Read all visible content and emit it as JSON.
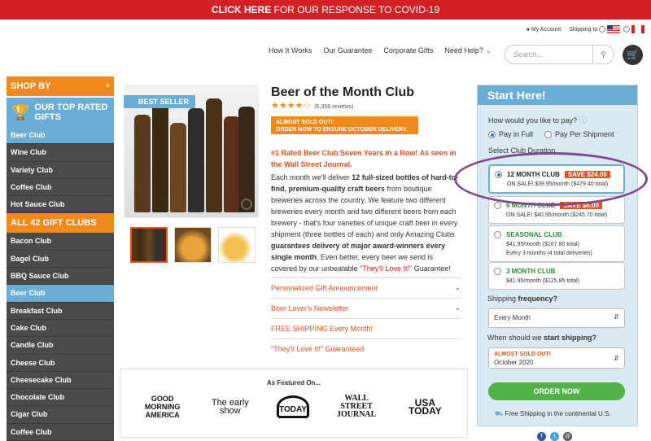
{
  "banner": {
    "click_here": "CLICK HERE",
    "text": " FOR OUR RESPONSE TO COVID-19"
  },
  "utility": {
    "account": "My Account",
    "shipping_to": "Shipping to"
  },
  "nav": {
    "items": [
      "How It Works",
      "Our Guarantee",
      "Corporate Gifts",
      "Need Help?"
    ]
  },
  "search": {
    "placeholder": "Search..."
  },
  "sidebar": {
    "shop_by": "SHOP BY",
    "top_rated": "OUR TOP RATED GIFTS",
    "top_items": [
      "Beer Club",
      "Wine Club",
      "Variety Club",
      "Coffee Club",
      "Hot Sauce Club"
    ],
    "all_clubs": "ALL 42 GIFT CLUBS",
    "all_items": [
      "Bacon Club",
      "Bagel Club",
      "BBQ Sauce Club",
      "Beer Club",
      "Breakfast Club",
      "Cake Club",
      "Candle Club",
      "Cheese Club",
      "Cheesecake Club",
      "Chocolate Club",
      "Cigar Club",
      "Coffee Club"
    ]
  },
  "product": {
    "badge": "BEST SELLER",
    "title": "Beer of the Month Club",
    "rating": 4.5,
    "reviews": "(5,358 reviews)",
    "soldout_line1": "ALMOST SOLD OUT!",
    "soldout_line2": "ORDER NOW TO ENSURE OCTOBER DELIVERY.",
    "rated_line": "#1 Rated Beer Club Seven Years in a Row! As seen in the Wall Street Journal.",
    "desc_1": "Each month we'll deliver ",
    "desc_2": "12 full-sized bottles of hard-to-find, premium-quality craft beers",
    "desc_3": " from boutique breweries across the country. We feature two different breweries every month and two different beers from each brewery - that's four varieties of unique craft beer in every shipment (three bottles of each) and only Amazing Clubs ",
    "desc_4": "guarantees delivery of major award-winners every single month",
    "desc_5": ". Even better, every beer we send is covered by our unbeatable ",
    "desc_6": "\"They'll Love It!\"",
    "desc_7": " Guarantee!",
    "accordions": [
      "Personalized Gift Announcement",
      "Beer Lover's Newsletter",
      "FREE SHIPPING Every Month!",
      "\"They'll Love It!\" Guaranteed"
    ]
  },
  "featured": {
    "heading": "As Featured On...",
    "logos": [
      "GOOD MORNING AMERICA",
      "The early show",
      "TODAY",
      "WALL STREET JOURNAL",
      "USA TODAY"
    ]
  },
  "panel": {
    "title": "Start Here!",
    "pay_q": "How would you like to pay?",
    "pay_options": [
      "Pay in Full",
      "Pay Per Shipment"
    ],
    "duration_label": "Select Club Duration",
    "options": [
      {
        "name": "12 MONTH CLUB",
        "save": "SAVE $24.00",
        "line": "ON SALE! $39.95/month ($479.40 total)"
      },
      {
        "name": "6 MONTH CLUB",
        "save": "SAVE $6.00",
        "line": "ON SALE! $40.95/month ($245.70 total)"
      },
      {
        "name": "SEASONAL CLUB",
        "line": "$41.95/month ($167.80 total)",
        "line2": "Every 3 months (4 total deliveries)"
      },
      {
        "name": "3 MONTH CLUB",
        "line": "$41.95/month ($125.85 total)"
      }
    ],
    "freq_label_1": "Shipping ",
    "freq_label_2": "frequency?",
    "freq_value": "Every Month",
    "start_label_1": "When should we ",
    "start_label_2": "start shipping?",
    "start_warn": "ALMOST SOLD OUT!",
    "start_value": "October 2020",
    "order_button": "ORDER NOW",
    "free_shipping": "Free Shipping in the continental U.S."
  }
}
